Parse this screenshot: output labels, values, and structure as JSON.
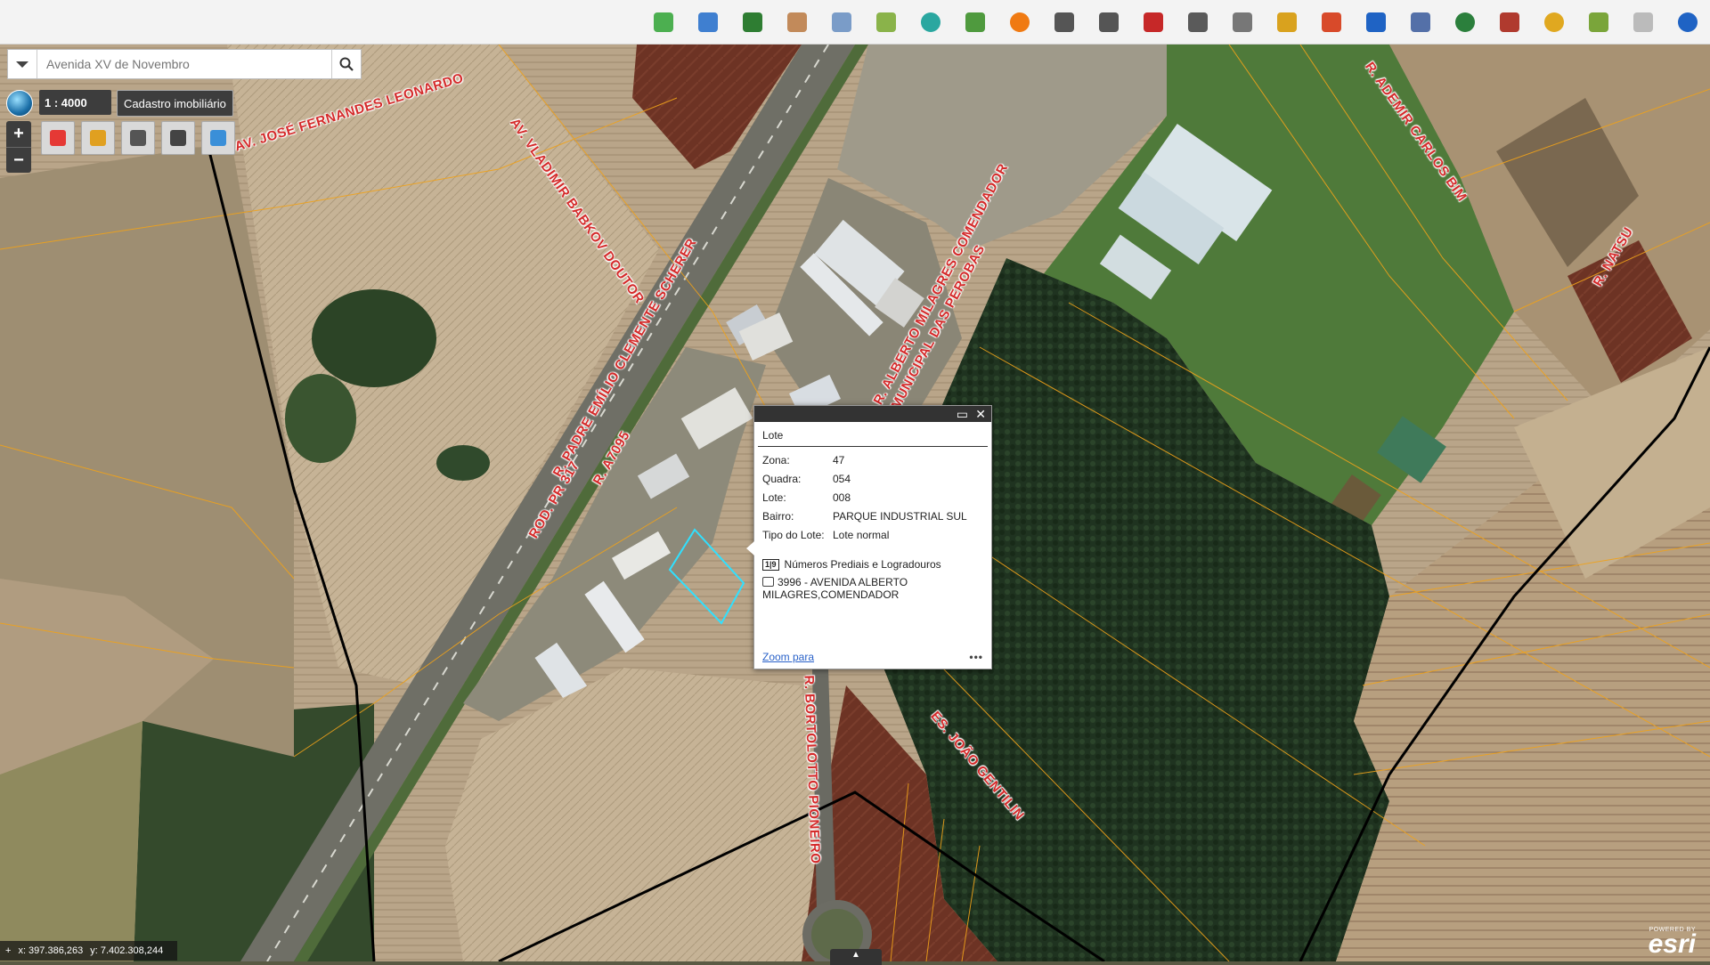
{
  "toolbar": {
    "icons": [
      {
        "name": "map-edit-icon",
        "color": "#4caf50"
      },
      {
        "name": "search-document-icon",
        "color": "#3f7fd0"
      },
      {
        "name": "layers-stack-icon",
        "color": "#2e7d32"
      },
      {
        "name": "hand-pan-icon",
        "color": "#c28a5a"
      },
      {
        "name": "coordinate-readout-icon",
        "color": "#7a9cc8"
      },
      {
        "name": "map-book-icon",
        "color": "#8ab34a"
      },
      {
        "name": "geolocation-icon",
        "color": "#2aa7a0"
      },
      {
        "name": "jigsaw-map-icon",
        "color": "#4f9a3e"
      },
      {
        "name": "orange-circle-icon",
        "color": "#f07a12"
      },
      {
        "name": "route-icon",
        "color": "#555555"
      },
      {
        "name": "network-icon",
        "color": "#555555"
      },
      {
        "name": "map-pin-icon",
        "color": "#c62828"
      },
      {
        "name": "list-icon",
        "color": "#5a5a5a"
      },
      {
        "name": "pencil-icon",
        "color": "#777777"
      },
      {
        "name": "measure-icon",
        "color": "#d9a21e"
      },
      {
        "name": "users-icon",
        "color": "#d84a2a"
      },
      {
        "name": "cloud-icon",
        "color": "#1f63c4"
      },
      {
        "name": "print-icon",
        "color": "#5470a8"
      },
      {
        "name": "globe-icon",
        "color": "#2b7f3c"
      },
      {
        "name": "book-icon",
        "color": "#b03a2e"
      },
      {
        "name": "globe-search-icon",
        "color": "#e0a820"
      },
      {
        "name": "document-check-icon",
        "color": "#7aa53a"
      },
      {
        "name": "download-icon",
        "color": "#bbbbbb"
      },
      {
        "name": "help-icon",
        "color": "#1f63c4"
      }
    ]
  },
  "search": {
    "placeholder": "Avenida XV de Novembro"
  },
  "scale": {
    "label": "1 : 4000"
  },
  "layer_label": "Cadastro imobiliário",
  "zoom": {
    "in": "+",
    "out": "−"
  },
  "map_tools": [
    {
      "name": "layers-tool-icon",
      "color": "#e53935"
    },
    {
      "name": "measure-tool-icon",
      "color": "#e0a020"
    },
    {
      "name": "draw-tool-icon",
      "color": "#555555"
    },
    {
      "name": "grid-tool-icon",
      "color": "#444444"
    },
    {
      "name": "clear-tool-icon",
      "color": "#3a8fd8"
    }
  ],
  "streets": [
    "AV. JOSÉ FERNANDES LEONARDO",
    "AV. VLADIMIR BABKOV DOUTOR",
    "R. PADRE EMÍLIO CLEMENTE SCHERER",
    "ROD. PR 317",
    "R. A7095",
    "R. ADEMIR CARLOS BIM",
    "R. NATSU",
    "R. ALBERTO MILAGRES COMENDADOR",
    "MUNICIPAL DAS PEROBAS",
    "ES. JOÃO GENTILIN",
    "R. BORTOLOTTO PIONEIRO"
  ],
  "popup": {
    "title": "Lote",
    "fields": [
      {
        "label": "Zona:",
        "value": "47"
      },
      {
        "label": "Quadra:",
        "value": "054"
      },
      {
        "label": "Lote:",
        "value": "008"
      },
      {
        "label": "Bairro:",
        "value": "PARQUE INDUSTRIAL SUL"
      },
      {
        "label": "Tipo do Lote:",
        "value": "Lote normal"
      }
    ],
    "related_badge": "1|9",
    "related_title": "Números Prediais e Logradouros",
    "address": "3996 - AVENIDA ALBERTO MILAGRES,COMENDADOR",
    "zoom_link": "Zoom para",
    "more": "•••",
    "maximize": "▭",
    "close": "✕"
  },
  "coords": {
    "x": "x: 397.386,263",
    "y": "y: 7.402.308,244"
  },
  "attribution": {
    "powered": "POWERED BY",
    "logo": "esri"
  }
}
